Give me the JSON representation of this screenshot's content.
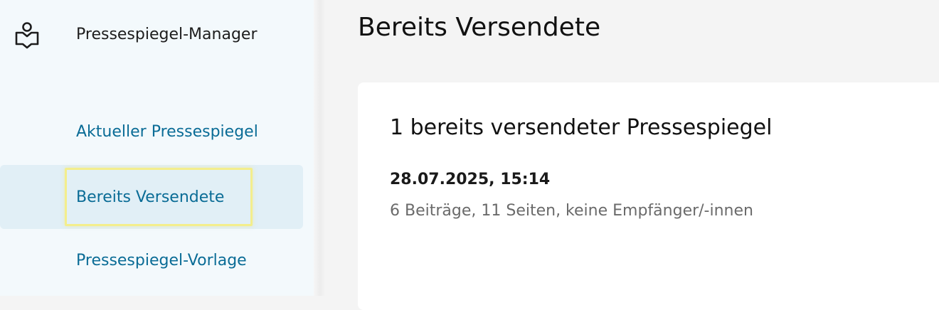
{
  "app": {
    "name": "Pressespiegel-Manager",
    "icon": "reader-book-icon"
  },
  "sidebar": {
    "items": [
      {
        "label": "Aktueller Pressespiegel",
        "active": false
      },
      {
        "label": "Bereits Versendete",
        "active": true
      },
      {
        "label": "Pressespiegel-Vorlage",
        "active": false
      }
    ]
  },
  "main": {
    "title": "Bereits Versendete",
    "card": {
      "heading": "1 bereits versendeter Pressespiegel",
      "entries": [
        {
          "date": "28.07.2025, 15:14",
          "meta": "6 Beiträge, 11 Seiten, keine Empfänger/-innen"
        }
      ]
    }
  },
  "colors": {
    "nav_link": "#0a6c96",
    "active_bg": "#e1eff6",
    "focus_ring": "#f3ee8c",
    "sidebar_bg": "#f3f9fc"
  }
}
